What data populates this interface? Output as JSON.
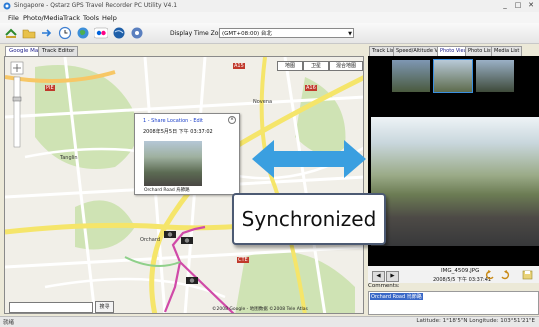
{
  "window": {
    "title": "Singapore - Qstarz GPS Travel Recorder PC Utility V4.1",
    "controls": [
      "_",
      "□",
      "✕"
    ]
  },
  "menu": [
    "File",
    "Photo/Media",
    "Track",
    "Tools",
    "Help"
  ],
  "toolbar": {
    "time_zone_label": "Display Time Zone:",
    "time_zone_value": "(GMT+08:00) 台北"
  },
  "left_tabs": [
    "Google Map",
    "Track Editor"
  ],
  "right_tabs": [
    "Track List",
    "Speed/Altitude View",
    "Photo View",
    "Photo List",
    "Media List"
  ],
  "map": {
    "view_buttons": [
      "地图",
      "卫星",
      "混合地图"
    ],
    "road_labels": [
      "Tanglin",
      "Novena",
      "Orchard",
      "A15",
      "A16",
      "PIE",
      "CTE"
    ],
    "popup": {
      "link_text": "1 - Share Location - Edit",
      "timestamp": "2008年5月5日 下午 03:37:02",
      "caption": "Orchard Road 烏節路",
      "close": "×"
    },
    "find_button": "搜寻",
    "copyright": "©2008 Google - 地图数据 ©2008 Tele Atlas"
  },
  "photo_view": {
    "prev": "◀",
    "next": "▶",
    "filename": "IMG_4509.JPG",
    "date": "2008/5/5 下午 03:37:41",
    "comments_label": "Comments:",
    "comment_text": "Orchard Road 烏節路"
  },
  "status": {
    "left": "就绪",
    "right": "Latitude: 1°18'5\"N  Longitude: 103°51'21\"E"
  },
  "annotation": {
    "text": "Synchronized"
  },
  "colors": {
    "arrow": "#3a9fe0",
    "track": "#d04aa8",
    "road_major": "#f5e56a",
    "road_minor": "#ffffff"
  }
}
